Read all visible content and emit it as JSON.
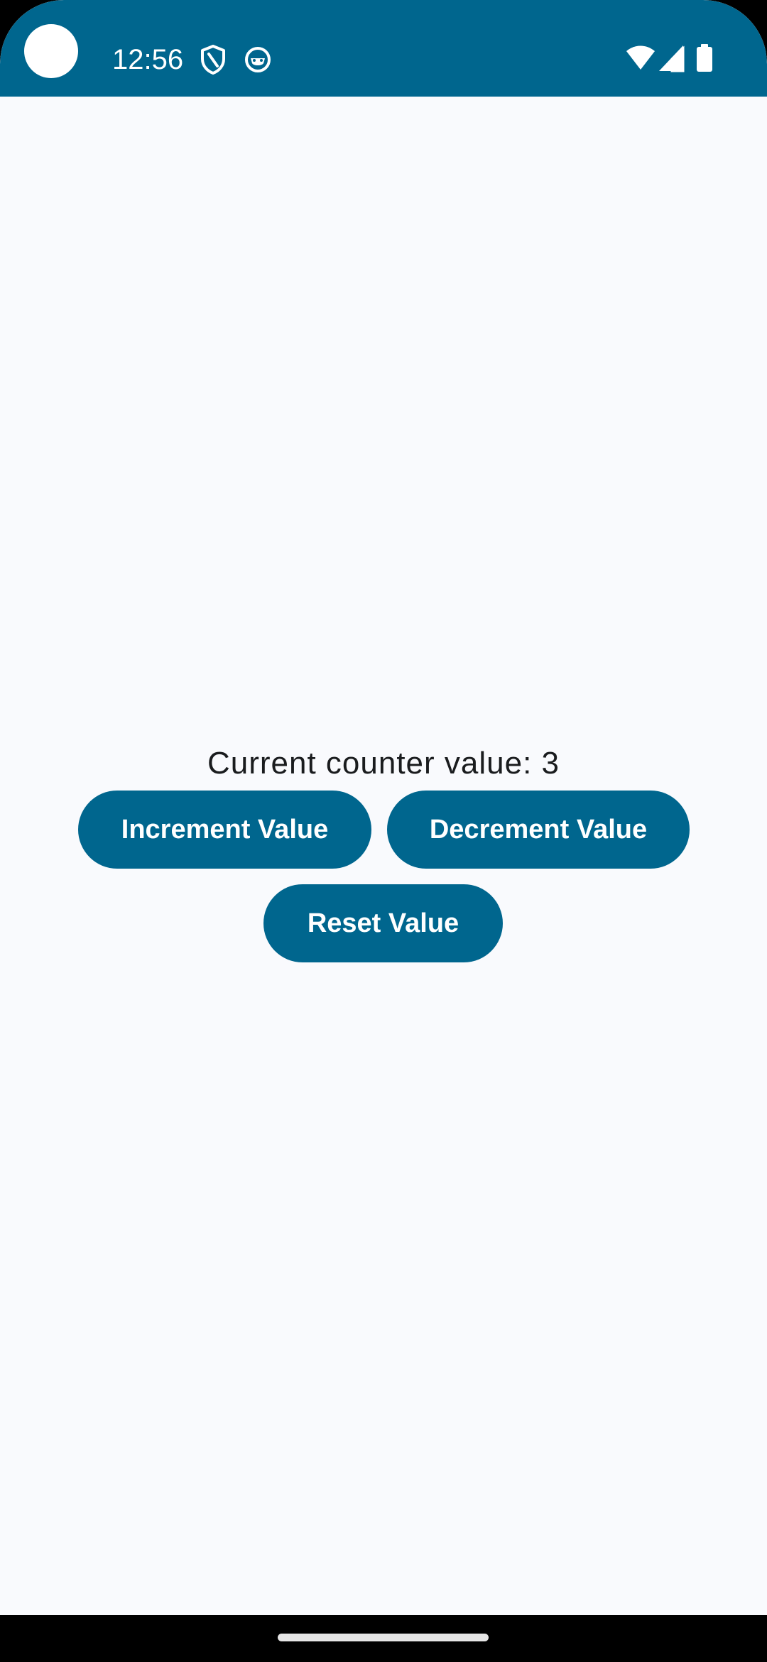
{
  "status_bar": {
    "time": "12:56",
    "background_color": "#00668e",
    "icons": [
      "shield-icon",
      "face-icon",
      "wifi-icon",
      "signal-icon",
      "battery-icon"
    ]
  },
  "main": {
    "counter_text": "Current counter value: 3",
    "buttons": {
      "increment_label": "Increment Value",
      "decrement_label": "Decrement Value",
      "reset_label": "Reset Value"
    },
    "button_color": "#00668e",
    "background_color": "#f9fafd"
  },
  "navigation": {
    "home_indicator": "home-indicator"
  }
}
